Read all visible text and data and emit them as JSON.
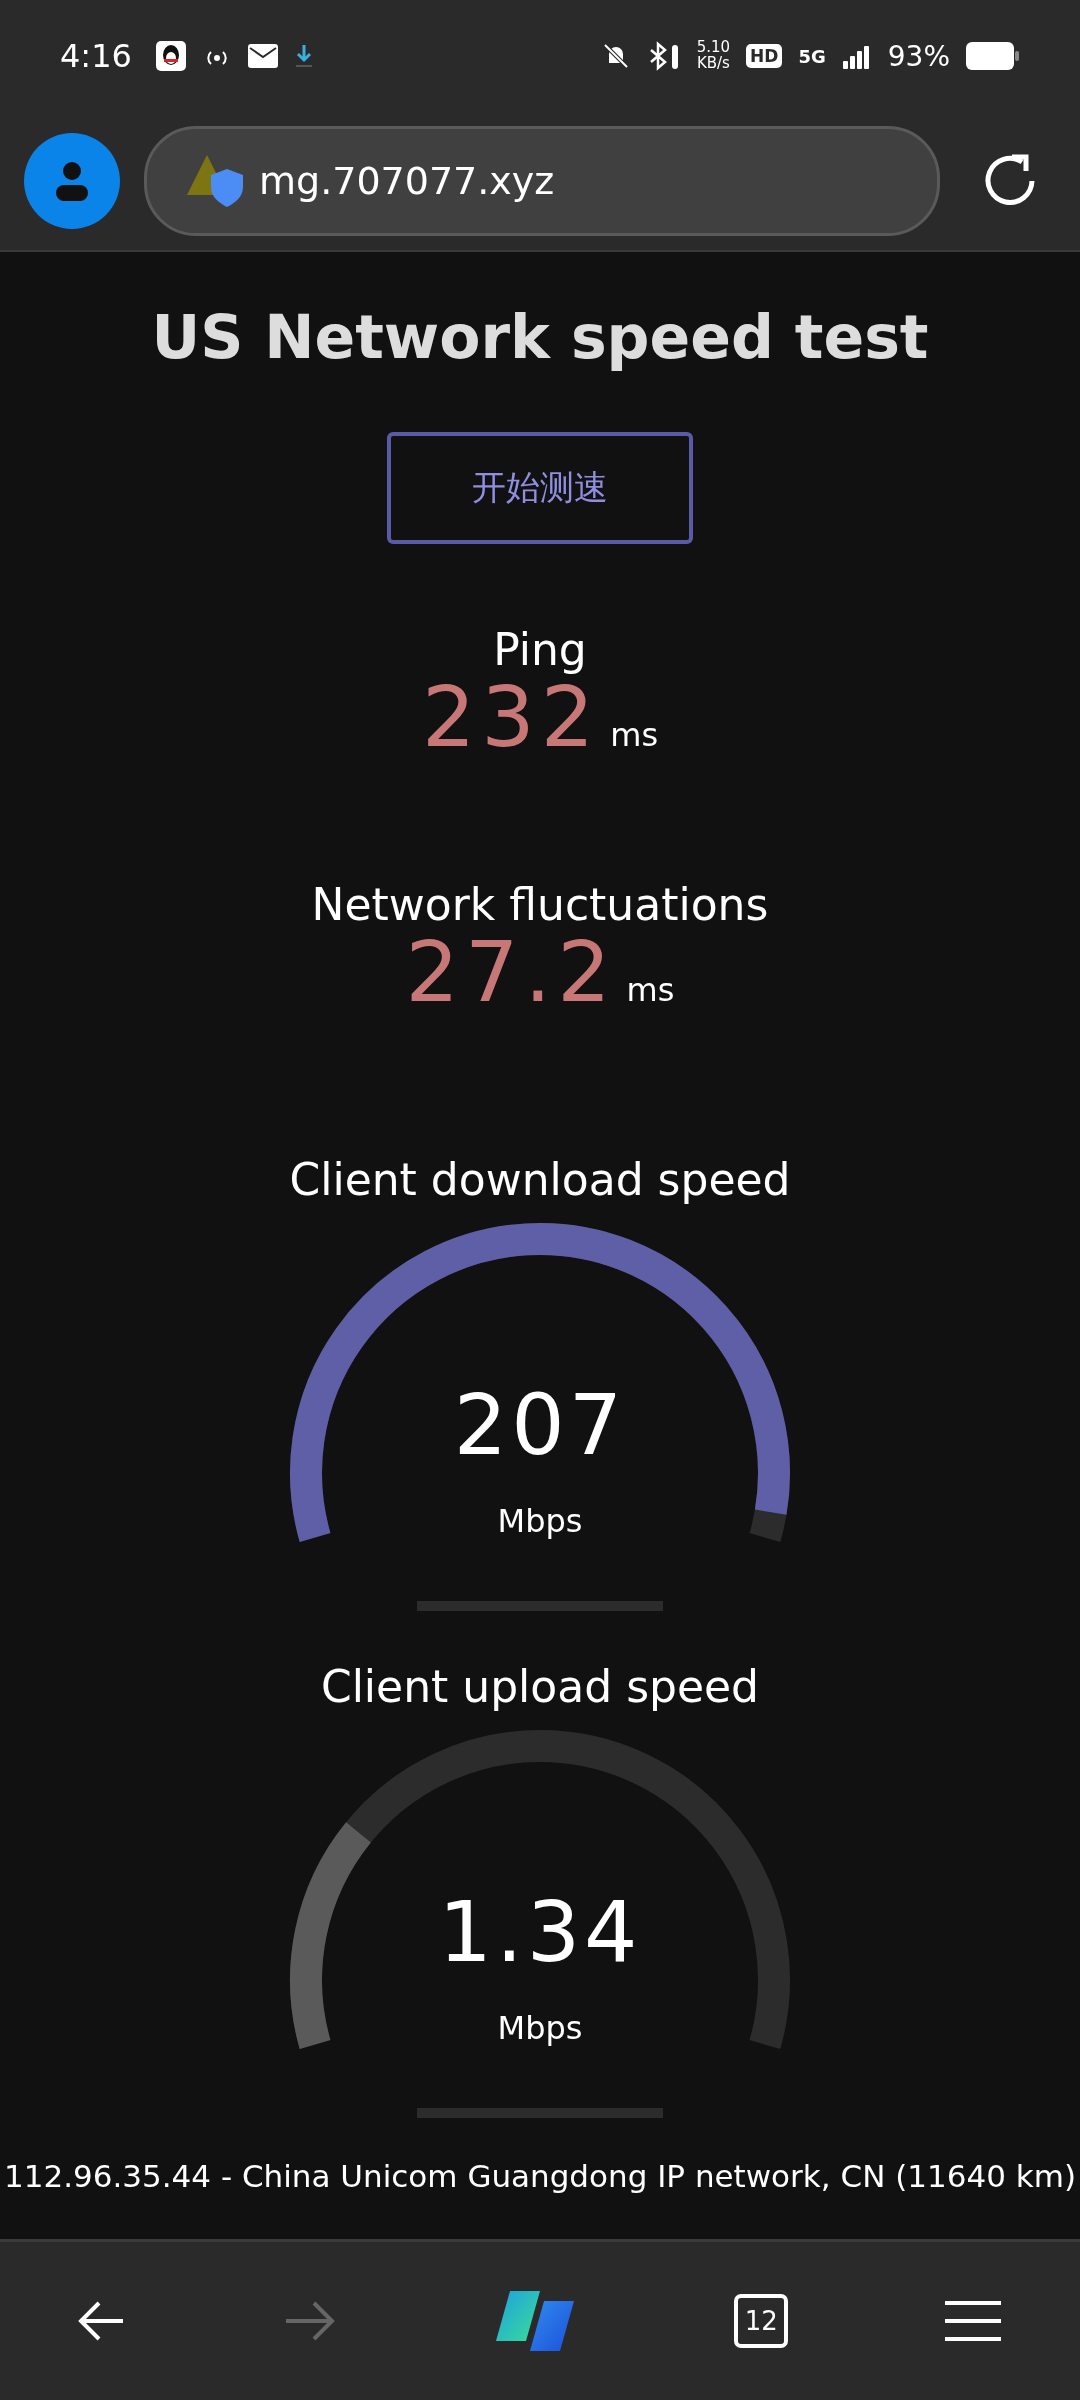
{
  "status_bar": {
    "time": "4:16",
    "speed": "5.10",
    "speed_unit": "KB/s",
    "hd": "HD",
    "network": "5G",
    "battery": "93%"
  },
  "address_bar": {
    "url": "mg.707077.xyz"
  },
  "page": {
    "title": "US Network speed test",
    "start_button": "开始测速",
    "metrics": [
      {
        "label": "Ping",
        "value": "232",
        "unit": "ms"
      },
      {
        "label": "Network fluctuations",
        "value": "27.2",
        "unit": "ms"
      }
    ],
    "gauges": [
      {
        "label": "Client download speed",
        "value": "207",
        "unit": "Mbps"
      },
      {
        "label": "Client upload speed",
        "value": "1.34",
        "unit": "Mbps"
      }
    ],
    "footer": "112.96.35.44 - China Unicom Guangdong IP network, CN (11640 km)"
  },
  "bottom_bar": {
    "tab_count": "12"
  }
}
